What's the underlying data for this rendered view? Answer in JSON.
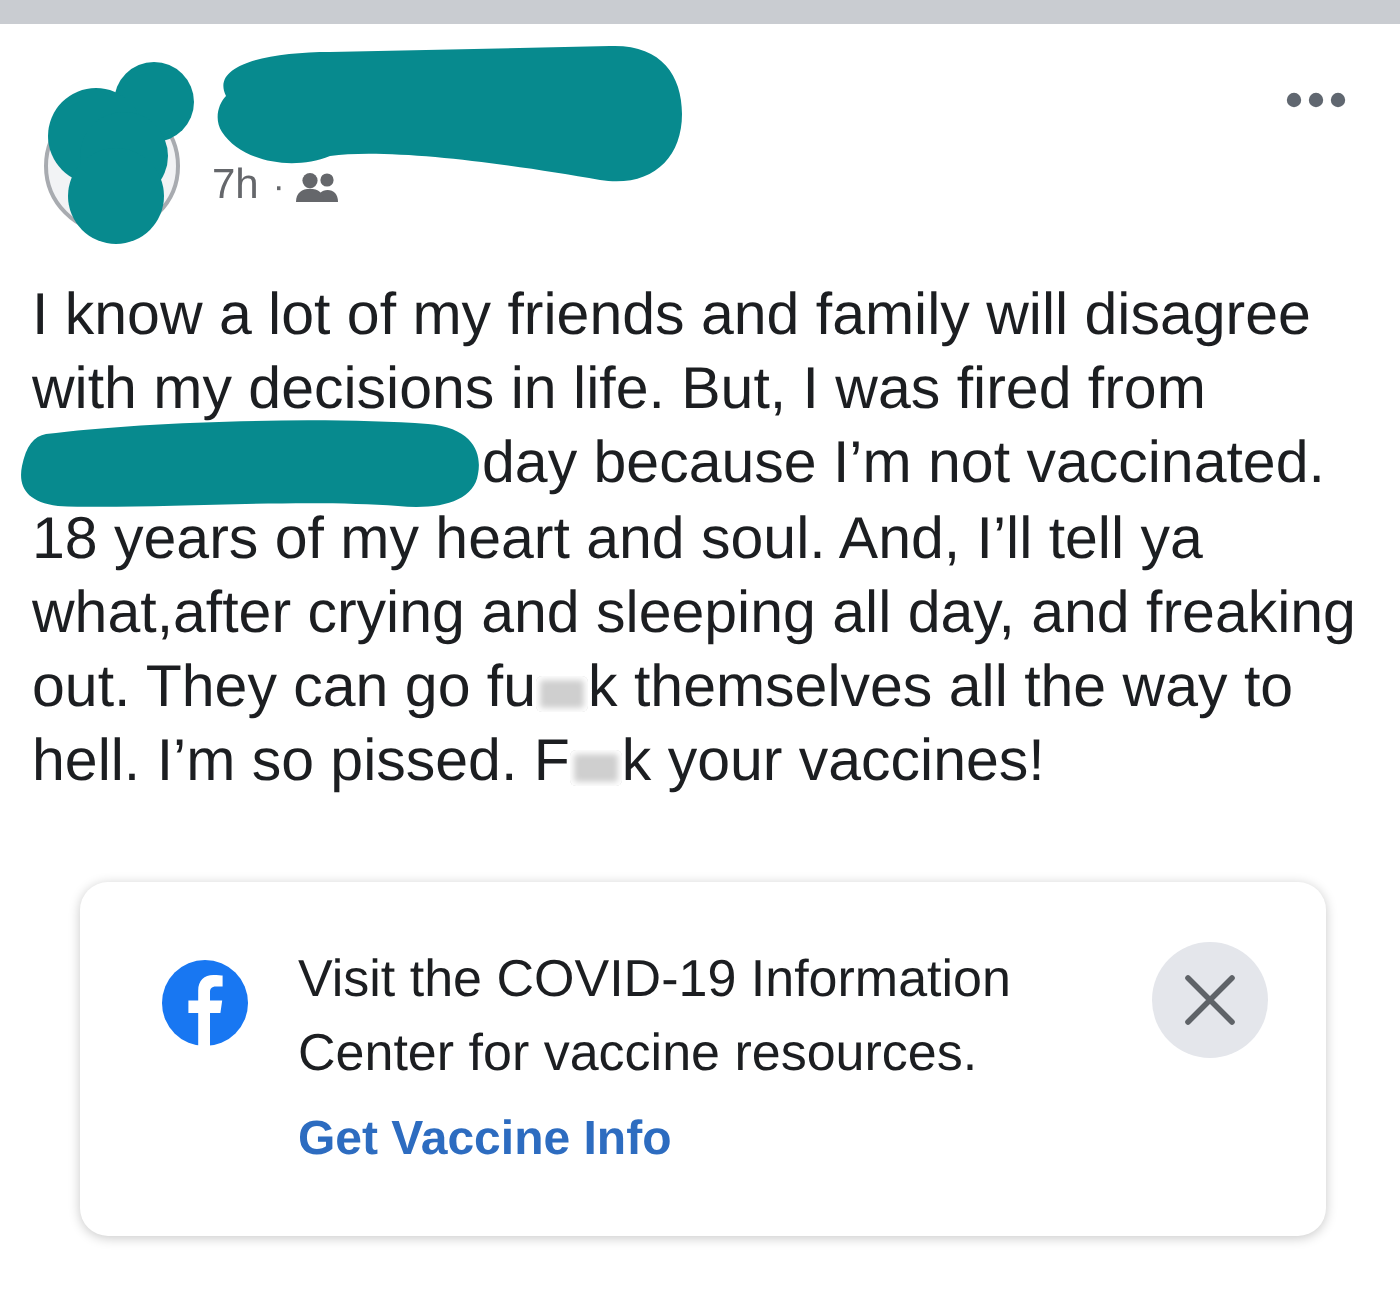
{
  "post": {
    "author": {
      "avatar_redacted": true,
      "name_redacted": true
    },
    "time": "7h",
    "separator": "·",
    "body": {
      "lines": [
        [
          {
            "kind": "text",
            "text": "I know a lot of my friends and family will disagree"
          }
        ],
        [
          {
            "kind": "text",
            "text": "with my decisions in life. But, I was fired from"
          }
        ],
        [
          {
            "kind": "redaction"
          },
          {
            "kind": "text",
            "text": "day because I’m not vaccinated."
          }
        ],
        [
          {
            "kind": "text",
            "text": "18 years of my heart and soul. And, I’ll tell ya"
          }
        ],
        [
          {
            "kind": "text",
            "text": "what,after crying and sleeping all day, and freaking"
          }
        ],
        [
          {
            "kind": "text",
            "text": "out. They can go fu"
          },
          {
            "kind": "blur"
          },
          {
            "kind": "text",
            "text": "k themselves all the way to"
          }
        ],
        [
          {
            "kind": "text",
            "text": "hell. I’m so pissed. F"
          },
          {
            "kind": "blur"
          },
          {
            "kind": "text",
            "text": "k your vaccines!"
          }
        ]
      ]
    }
  },
  "info_card": {
    "text": "Visit the COVID-19 Information Center for vaccine resources.",
    "link": "Get Vaccine Info"
  }
}
